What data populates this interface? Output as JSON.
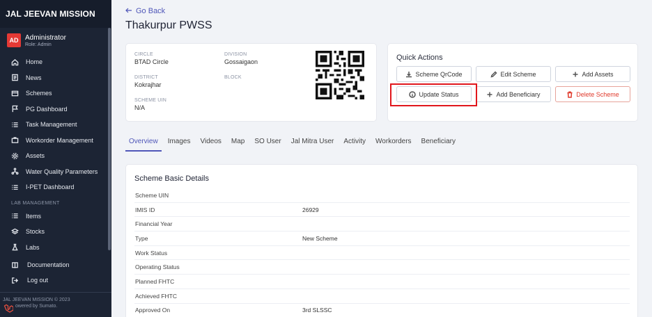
{
  "brand": "JAL JEEVAN MISSION",
  "user": {
    "initials": "AD",
    "name": "Administrator",
    "role": "Role: Admin"
  },
  "nav": [
    {
      "label": "Home",
      "icon": "home-icon"
    },
    {
      "label": "News",
      "icon": "news-icon"
    },
    {
      "label": "Schemes",
      "icon": "schemes-icon"
    },
    {
      "label": "PG Dashboard",
      "icon": "flag-icon"
    },
    {
      "label": "Task Management",
      "icon": "list-icon"
    },
    {
      "label": "Workorder Management",
      "icon": "briefcase-icon"
    },
    {
      "label": "Assets",
      "icon": "gear-icon"
    },
    {
      "label": "Water Quality Parameters",
      "icon": "network-icon"
    },
    {
      "label": "I-PET Dashboard",
      "icon": "list-icon"
    }
  ],
  "lab_section": "LAB MANAGEMENT",
  "lab_nav": [
    {
      "label": "Items",
      "icon": "list-icon"
    },
    {
      "label": "Stocks",
      "icon": "layers-icon"
    },
    {
      "label": "Labs",
      "icon": "flask-icon"
    }
  ],
  "bottom_nav": [
    {
      "label": "Documentation",
      "icon": "book-icon"
    },
    {
      "label": "Log out",
      "icon": "logout-icon"
    }
  ],
  "footer": {
    "line1": "JAL JEEVAN MISSION © 2023",
    "line2": "owered by Sumato."
  },
  "go_back": "Go Back",
  "title": "Thakurpur PWSS",
  "info": {
    "circle_label": "CIRCLE",
    "circle_value": "BTAD Circle",
    "division_label": "DIVISION",
    "division_value": "Gossaigaon",
    "district_label": "DISTRICT",
    "district_value": "Kokrajhar",
    "block_label": "BLOCK",
    "block_value": "",
    "uin_label": "SCHEME UIN",
    "uin_value": "N/A"
  },
  "quick_actions": {
    "title": "Quick Actions",
    "qrcode": "Scheme QrCode",
    "edit": "Edit Scheme",
    "add_assets": "Add Assets",
    "update_status": "Update Status",
    "add_beneficiary": "Add Beneficiary",
    "delete": "Delete Scheme"
  },
  "tabs": [
    "Overview",
    "Images",
    "Videos",
    "Map",
    "SO User",
    "Jal Mitra User",
    "Activity",
    "Workorders",
    "Beneficiary"
  ],
  "details": {
    "title": "Scheme Basic Details",
    "rows": [
      {
        "k": "Scheme UIN",
        "v": ""
      },
      {
        "k": "IMIS ID",
        "v": "26929"
      },
      {
        "k": "Financial Year",
        "v": ""
      },
      {
        "k": "Type",
        "v": "New Scheme"
      },
      {
        "k": "Work Status",
        "v": ""
      },
      {
        "k": "Operating Status",
        "v": ""
      },
      {
        "k": "Planned FHTC",
        "v": ""
      },
      {
        "k": "Achieved FHTC",
        "v": ""
      },
      {
        "k": "Approved On",
        "v": "3rd SLSSC"
      }
    ]
  },
  "colors": {
    "sidebar": "#1c2434",
    "accent": "#4f56b8",
    "danger": "#e0392b",
    "highlight": "#e1161c"
  }
}
